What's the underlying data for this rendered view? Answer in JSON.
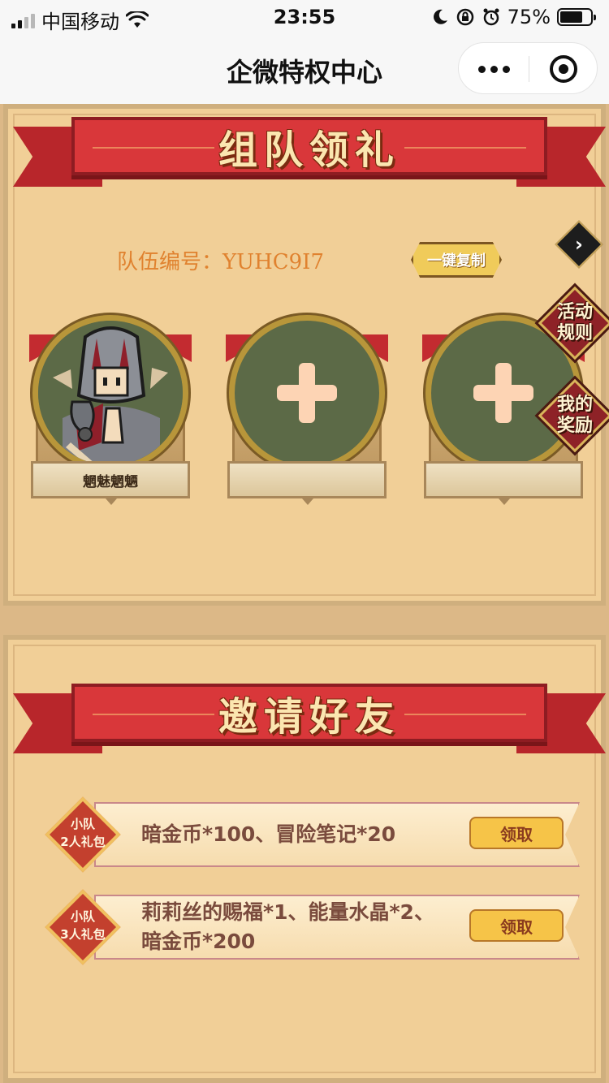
{
  "status_bar": {
    "carrier": "中国移动",
    "time": "23:55",
    "battery": "75%",
    "battery_level": 0.75
  },
  "nav": {
    "title": "企微特权中心"
  },
  "team_section": {
    "title": "组队领礼",
    "team_number": "队伍编号：YUHC9I7",
    "copy_button": "一键复制",
    "members": [
      {
        "name": "魍魅魍魉",
        "filled": true
      },
      {
        "name": "",
        "filled": false
      },
      {
        "name": "",
        "filled": false
      }
    ],
    "side_buttons": [
      "活动\n规则",
      "我的\n奖励"
    ]
  },
  "invite_section": {
    "title": "邀请好友",
    "rewards": [
      {
        "badge": "小队\n2人礼包",
        "items": "暗金币*100、冒险笔记*20",
        "button": "领取"
      },
      {
        "badge": "小队\n3人礼包",
        "items": "莉莉丝的赐福*1、能量水晶*2、暗金币*200",
        "button": "领取"
      }
    ]
  },
  "colors": {
    "ribbon": "#d9373a",
    "panel": "#f1cf97",
    "accent_orange": "#e0822f",
    "button_gold": "#f6c448"
  }
}
